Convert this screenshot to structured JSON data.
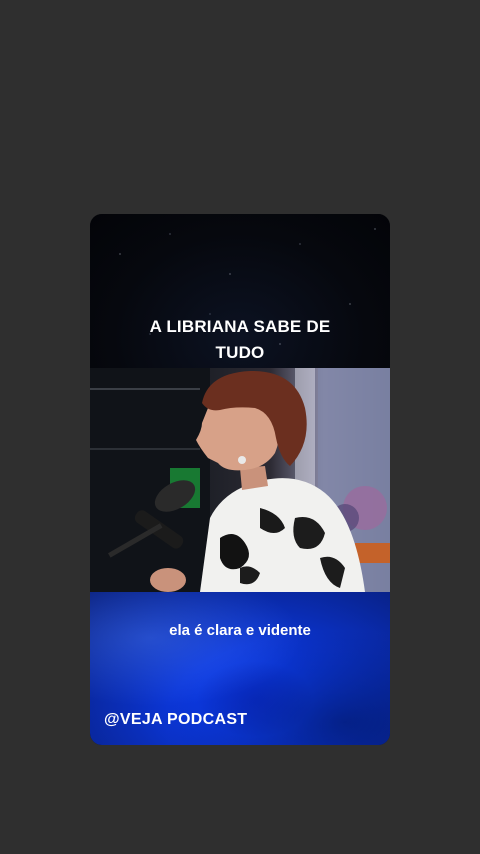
{
  "story": {
    "headline": "A LIBRIANA SABE DE TUDO",
    "subtitle": "ela é clara e vidente",
    "handle": "@VEJA PODCAST"
  },
  "colors": {
    "page_background": "#2f2f2f",
    "top_panel": "#05070c",
    "bottom_panel": "#0c3ae6",
    "text": "#ffffff"
  },
  "icons": {
    "video_frame": "podcast-video-frame"
  }
}
